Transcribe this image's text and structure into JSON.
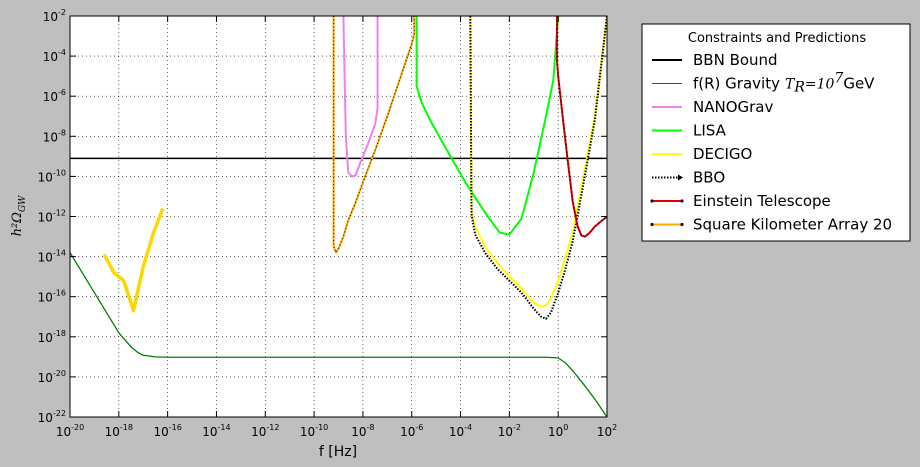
{
  "chart_data": {
    "type": "line",
    "title": "",
    "xlabel": "f [Hz]",
    "ylabel": "h²Ω",
    "ylabel_sub": "GW",
    "xscale": "log",
    "yscale": "log",
    "xlim": [
      1e-20,
      100
    ],
    "ylim": [
      1e-22,
      0.01
    ],
    "grid": true,
    "legend_position": "right",
    "legend_title": "Constraints and Predictions",
    "x_ticks": [
      {
        "base": "10",
        "exp": "-20"
      },
      {
        "base": "10",
        "exp": "-18"
      },
      {
        "base": "10",
        "exp": "-16"
      },
      {
        "base": "10",
        "exp": "-14"
      },
      {
        "base": "10",
        "exp": "-12"
      },
      {
        "base": "10",
        "exp": "-10"
      },
      {
        "base": "10",
        "exp": "-8"
      },
      {
        "base": "10",
        "exp": "-6"
      },
      {
        "base": "10",
        "exp": "-4"
      },
      {
        "base": "10",
        "exp": "-2"
      },
      {
        "base": "10",
        "exp": "0"
      },
      {
        "base": "10",
        "exp": "2"
      }
    ],
    "y_ticks": [
      {
        "base": "10",
        "exp": "-22"
      },
      {
        "base": "10",
        "exp": "-20"
      },
      {
        "base": "10",
        "exp": "-18"
      },
      {
        "base": "10",
        "exp": "-16"
      },
      {
        "base": "10",
        "exp": "-14"
      },
      {
        "base": "10",
        "exp": "-12"
      },
      {
        "base": "10",
        "exp": "-10"
      },
      {
        "base": "10",
        "exp": "-8"
      },
      {
        "base": "10",
        "exp": "-6"
      },
      {
        "base": "10",
        "exp": "-4"
      },
      {
        "base": "10",
        "exp": "-2"
      }
    ],
    "series": [
      {
        "name": "BBN Bound",
        "color": "#000000",
        "width": 1.5,
        "style": "solid",
        "x_log": [
          -20,
          2
        ],
        "y_log": [
          -9.1,
          -9.1
        ]
      },
      {
        "name": "f(R) Gravity",
        "name_math": "T",
        "name_math_sub": "R",
        "name_math_rest": "=10",
        "name_math_sup": "7",
        "name_suffix": "GeV",
        "color": "#008000",
        "width": 1.3,
        "style": "solid",
        "x_log": [
          -20,
          -19,
          -18,
          -17.5,
          -17.2,
          -17,
          -16.5,
          -16,
          -12,
          -8,
          -4,
          -2,
          -0.5,
          0,
          0.3,
          0.6,
          1,
          1.5,
          2
        ],
        "y_log": [
          -13.8,
          -15.8,
          -17.8,
          -18.5,
          -18.8,
          -18.92,
          -19.0,
          -19.02,
          -19.02,
          -19.02,
          -19.02,
          -19.02,
          -19.02,
          -19.05,
          -19.3,
          -19.7,
          -20.3,
          -21.1,
          -22
        ]
      },
      {
        "name": "NANOGrav",
        "color": "#ee82ee",
        "width": 2,
        "style": "solid",
        "x_log": [
          -8.8,
          -8.75,
          -8.7,
          -8.6,
          -8.45,
          -8.3,
          -8.1,
          -7.8,
          -7.5,
          -7.4,
          -7.4
        ],
        "y_log": [
          -2,
          -5,
          -8,
          -9.8,
          -10.0,
          -9.95,
          -9.3,
          -8.4,
          -7.4,
          -6.6,
          -2
        ]
      },
      {
        "name": "LISA",
        "color": "#00ff00",
        "width": 2,
        "style": "solid",
        "x_log": [
          -5.8,
          -5.8,
          -5.6,
          -5.2,
          -4.6,
          -3.8,
          -3.0,
          -2.4,
          -2.0,
          -1.5,
          -1.0,
          -0.5,
          -0.2,
          0.0
        ],
        "y_log": [
          -2,
          -5.5,
          -6.3,
          -7.3,
          -8.6,
          -10.3,
          -11.8,
          -12.8,
          -12.9,
          -12.1,
          -9.8,
          -7.0,
          -5.2,
          -2
        ]
      },
      {
        "name": "DECIGO",
        "color": "#ffff00",
        "width": 2,
        "style": "solid",
        "x_log": [
          -3.6,
          -3.55,
          -3.4,
          -3.0,
          -2.5,
          -2.0,
          -1.5,
          -1.0,
          -0.7,
          -0.5,
          -0.3,
          0.0,
          0.3,
          0.6,
          1.0,
          1.5,
          2.0
        ],
        "y_log": [
          -2,
          -11.8,
          -12.5,
          -13.5,
          -14.3,
          -15.0,
          -15.6,
          -16.3,
          -16.5,
          -16.45,
          -16.1,
          -15.2,
          -14.0,
          -12.8,
          -10.2,
          -7.0,
          -2
        ]
      },
      {
        "name": "BBO",
        "color": "#000000",
        "width": 2,
        "style": "dotted",
        "x_log": [
          -3.6,
          -3.55,
          -3.4,
          -3.0,
          -2.5,
          -2.0,
          -1.5,
          -1.0,
          -0.7,
          -0.5,
          -0.3,
          0.0,
          0.3,
          0.6,
          1.0,
          1.5,
          2.0
        ],
        "y_log": [
          -2,
          -11.9,
          -12.9,
          -13.8,
          -14.6,
          -15.2,
          -15.8,
          -16.6,
          -17.0,
          -17.1,
          -16.8,
          -15.8,
          -14.6,
          -13.2,
          -10.6,
          -7.2,
          -2
        ]
      },
      {
        "name": "Einstein Telescope",
        "color": "#dd0000",
        "width": 2,
        "style": "solid",
        "x_log": [
          -0.05,
          -0.05,
          0.0,
          0.2,
          0.4,
          0.6,
          0.8,
          0.95,
          1.1,
          1.3,
          1.5,
          1.8,
          2.0
        ],
        "y_log": [
          -2,
          -4.2,
          -5.0,
          -7.2,
          -9.3,
          -11.3,
          -12.5,
          -12.95,
          -13.0,
          -12.8,
          -12.5,
          -12.2,
          -12.0
        ]
      },
      {
        "name": "Square Kilometer Array 20",
        "color": "#ffa500",
        "width": 2,
        "style": "solid",
        "x_log": [
          -9.2,
          -9.2,
          -9.1,
          -9.0,
          -8.8,
          -8.6,
          -8.3,
          -8.0,
          -7.5,
          -7.0,
          -6.5,
          -6.0,
          -5.9,
          -5.9
        ],
        "y_log": [
          -2,
          -13.5,
          -13.8,
          -13.6,
          -13.0,
          -12.2,
          -11.3,
          -10.3,
          -8.7,
          -7.0,
          -5.2,
          -3.4,
          -2.9,
          -2
        ]
      },
      {
        "name": "",
        "color": "#ffd700",
        "width": 3.5,
        "style": "solid",
        "x_log": [
          -18.6,
          -18.2,
          -17.8,
          -17.4,
          -17.0,
          -16.6,
          -16.2
        ],
        "y_log": [
          -13.9,
          -14.8,
          -15.2,
          -16.7,
          -14.5,
          -12.9,
          -11.6
        ]
      }
    ]
  }
}
